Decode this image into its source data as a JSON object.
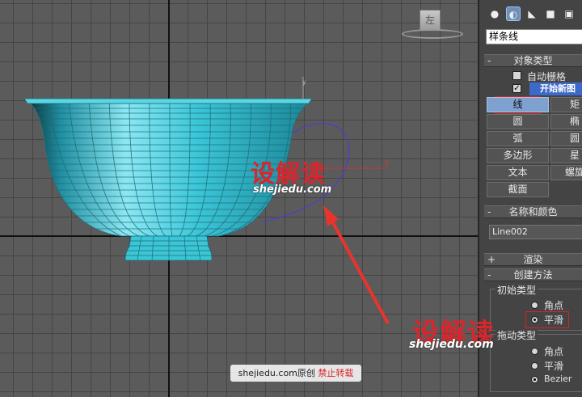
{
  "viewport": {
    "viewcube_label": "左",
    "watermark": {
      "brand": "设解读",
      "url": "shejiedu.com"
    },
    "credit": {
      "site": "shejiedu.com原创",
      "notice": "禁止转载"
    }
  },
  "panel": {
    "category": "样条线",
    "tab_icons": [
      "sphere-icon",
      "create-icon",
      "light-icon",
      "camera-icon",
      "helper-icon"
    ],
    "object_type": {
      "title": "对象类型",
      "autogrid_label": "自动栅格",
      "autogrid_checked": false,
      "start_new_shape_label": "开始新图",
      "start_new_shape_checked": true,
      "buttons": [
        {
          "label": "线",
          "active": true
        },
        {
          "label": "矩",
          "active": false
        },
        {
          "label": "圆",
          "active": false
        },
        {
          "label": "椭",
          "active": false
        },
        {
          "label": "弧",
          "active": false
        },
        {
          "label": "圆",
          "active": false
        },
        {
          "label": "多边形",
          "active": false
        },
        {
          "label": "星",
          "active": false
        },
        {
          "label": "文本",
          "active": false
        },
        {
          "label": "螺旋",
          "active": false
        },
        {
          "label": "截面",
          "active": false
        }
      ]
    },
    "name_color": {
      "title": "名称和颜色",
      "name_value": "Line002"
    },
    "rendering": {
      "title": "渲染",
      "toggle": "+"
    },
    "creation_method": {
      "title": "创建方法",
      "toggle": "-",
      "initial_type_label": "初始类型",
      "initial_options": [
        {
          "label": "角点",
          "selected": false
        },
        {
          "label": "平滑",
          "selected": true
        }
      ],
      "drag_type_label": "拖动类型",
      "drag_options": [
        {
          "label": "角点",
          "selected": false
        },
        {
          "label": "平滑",
          "selected": false
        },
        {
          "label": "Bezier",
          "selected": true
        }
      ]
    },
    "rollout_toggle": "-"
  },
  "colors": {
    "cup": "#3bc6d8",
    "spline": "#4a3fd0",
    "arrow": "#e8342c",
    "active_button": "#7fa1cf",
    "watermark": "#d8262c"
  }
}
